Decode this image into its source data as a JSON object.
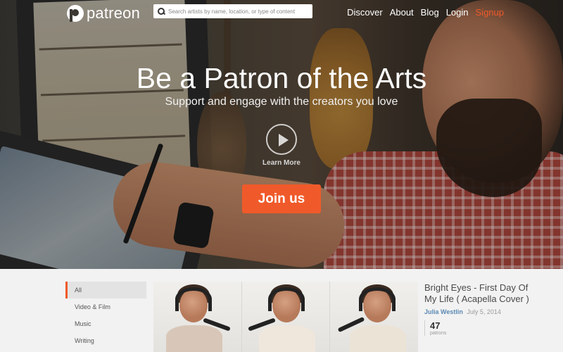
{
  "brand": {
    "logo_text": "patreon",
    "logo_icon": "patreon-p-logo",
    "accent": "#f05a2a"
  },
  "search": {
    "placeholder": "Search artists by name, location, or type of content",
    "icon": "search-icon"
  },
  "nav": {
    "discover": "Discover",
    "about": "About",
    "blog": "Blog",
    "login": "Login",
    "signup": "Signup"
  },
  "hero": {
    "title": "Be a Patron of the Arts",
    "subtitle": "Support and engage with the creators you love",
    "play_icon": "play-icon",
    "learn_more": "Learn More",
    "cta": "Join us"
  },
  "categories": [
    "All",
    "Video & Film",
    "Music",
    "Writing"
  ],
  "featured": {
    "title": "Bright Eyes - First Day Of My Life ( Acapella Cover )",
    "author": "Julia Westlin",
    "date": "July 5, 2014",
    "patrons_count": "47",
    "patrons_label": "patrons"
  }
}
